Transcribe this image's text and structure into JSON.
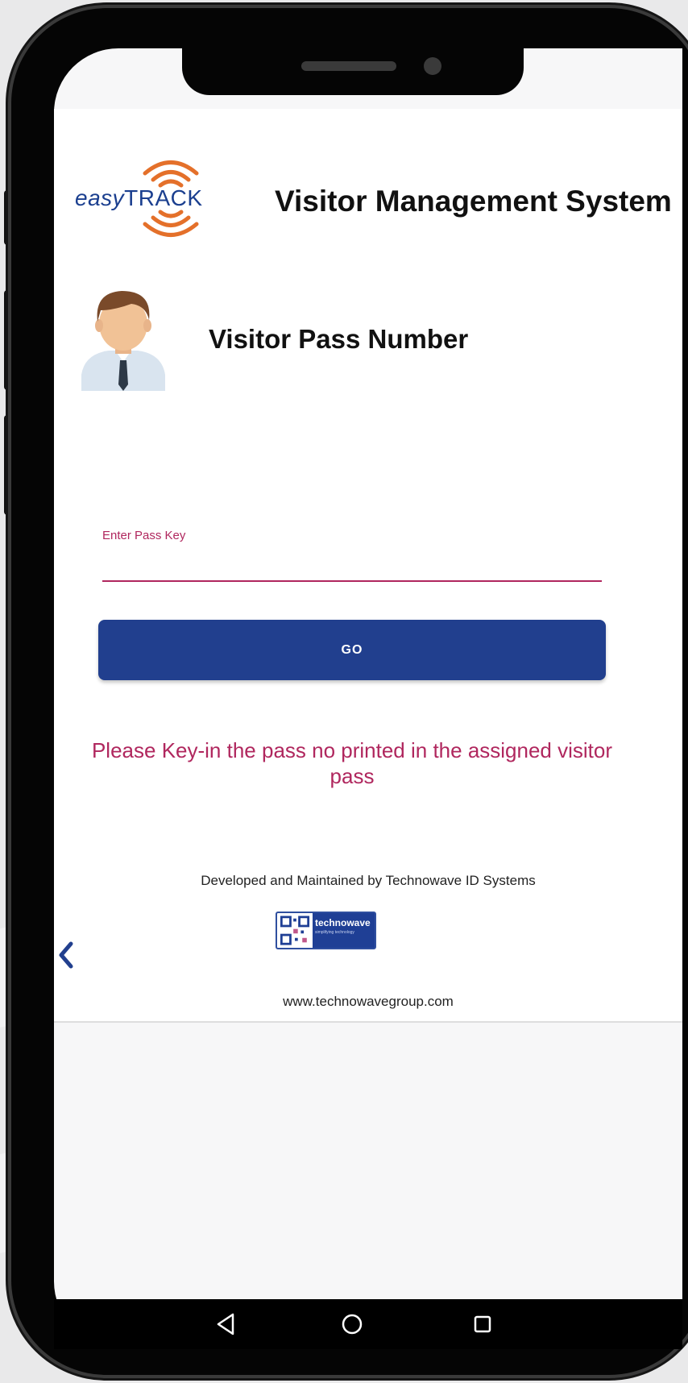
{
  "header": {
    "logo_easy": "easy",
    "logo_track": "TRACK",
    "title": "Visitor Management System"
  },
  "pass": {
    "heading": "Visitor Pass Number",
    "input_label": "Enter Pass Key",
    "input_value": "",
    "go_label": "GO",
    "instruction": "Please Key-in the pass no printed in the assigned visitor pass"
  },
  "footer": {
    "developer": "Developed and Maintained by Technowave ID Systems",
    "brand": "technowave",
    "brand_tagline": "simplifying technology",
    "website": "www.technowavegroup.com"
  },
  "colors": {
    "primary": "#213f8e",
    "accent": "#b0275e",
    "logo_orange": "#e4702a"
  },
  "icons": {
    "back": "chevron-left-icon",
    "nav_back": "triangle-back-icon",
    "nav_home": "circle-home-icon",
    "nav_recent": "square-recent-icon"
  }
}
